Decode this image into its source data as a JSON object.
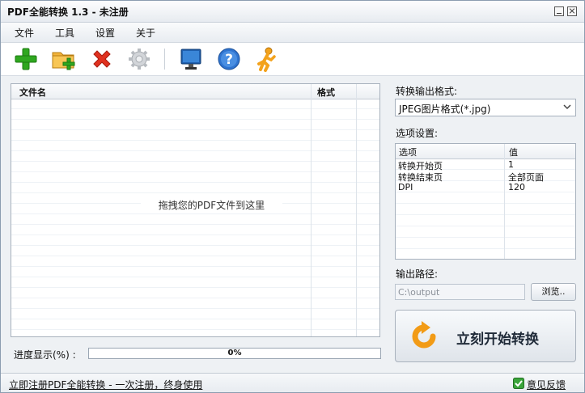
{
  "window": {
    "title": "PDF全能转换 1.3 - 未注册"
  },
  "menu": {
    "items": [
      "文件",
      "工具",
      "设置",
      "关于"
    ]
  },
  "toolbar": {
    "icons": [
      "add-icon",
      "add-folder-icon",
      "delete-icon",
      "settings-gear-icon",
      "monitor-icon",
      "help-icon",
      "runner-icon"
    ]
  },
  "file_list": {
    "columns": [
      "文件名",
      "格式"
    ],
    "drop_hint": "拖拽您的PDF文件到这里"
  },
  "output_format": {
    "label": "转换输出格式:",
    "selected": "JPEG图片格式(*.jpg)"
  },
  "options": {
    "label": "选项设置:",
    "columns": [
      "选项",
      "值"
    ],
    "rows": [
      [
        "转换开始页",
        "1"
      ],
      [
        "转换结束页",
        "全部页面"
      ],
      [
        "DPI",
        "120"
      ]
    ]
  },
  "output_path": {
    "label": "输出路径:",
    "value": "C:\\output",
    "browse_label": "浏览.."
  },
  "start_button": {
    "label": "立刻开始转换"
  },
  "progress": {
    "label": "进度显示(%) :",
    "value": 0,
    "text": "0%"
  },
  "status": {
    "register_link": "立即注册PDF全能转换 - 一次注册，终身使用",
    "feedback": "意见反馈"
  },
  "colors": {
    "accent": "#5c9fe0",
    "add_green": "#2fa71f",
    "delete_red": "#e0311f",
    "help_blue": "#2f74d0"
  }
}
